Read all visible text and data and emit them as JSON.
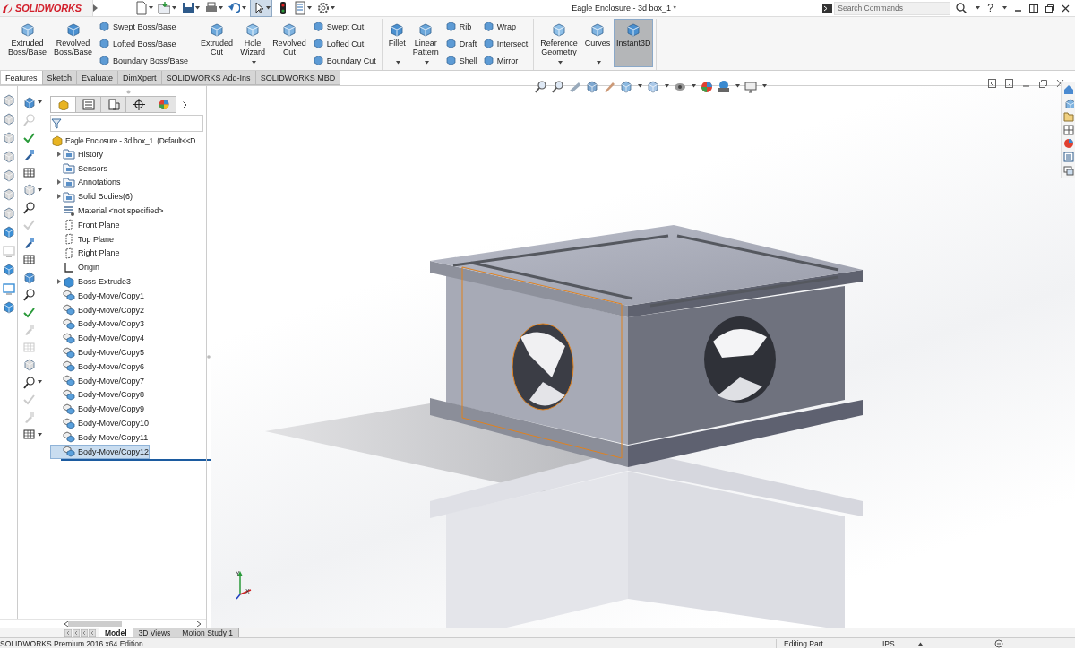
{
  "window": {
    "logo": "SOLIDWORKS",
    "title": "Eagle Enclosure - 3d box_1 *"
  },
  "search": {
    "placeholder": "Search Commands"
  },
  "help": "?",
  "ribbon": {
    "groups": [
      {
        "columns": [
          {
            "kind": "large",
            "label": "Extruded Boss/Base",
            "dropdown": false,
            "selected": false
          },
          {
            "kind": "large",
            "label": "Revolved Boss/Base",
            "dropdown": false,
            "selected": false
          },
          {
            "kind": "small",
            "items": [
              "Swept Boss/Base",
              "Lofted Boss/Base",
              "Boundary Boss/Base"
            ]
          }
        ]
      },
      {
        "columns": [
          {
            "kind": "large",
            "label": "Extruded Cut",
            "dropdown": false,
            "selected": false
          },
          {
            "kind": "large",
            "label": "Hole Wizard",
            "dropdown": true,
            "selected": false
          },
          {
            "kind": "large",
            "label": "Revolved Cut",
            "dropdown": false,
            "selected": false
          },
          {
            "kind": "small",
            "items": [
              "Swept Cut",
              "Lofted Cut",
              "Boundary Cut"
            ]
          }
        ]
      },
      {
        "columns": [
          {
            "kind": "large",
            "label": "Fillet",
            "dropdown": true,
            "selected": false
          },
          {
            "kind": "large",
            "label": "Linear Pattern",
            "dropdown": true,
            "selected": false
          },
          {
            "kind": "small",
            "items": [
              "Rib",
              "Draft",
              "Shell"
            ]
          },
          {
            "kind": "small",
            "items": [
              "Wrap",
              "Intersect",
              "Mirror"
            ]
          }
        ]
      },
      {
        "columns": [
          {
            "kind": "large",
            "label": "Reference Geometry",
            "dropdown": true,
            "selected": false
          },
          {
            "kind": "large",
            "label": "Curves",
            "dropdown": true,
            "selected": false
          },
          {
            "kind": "large",
            "label": "Instant3D",
            "dropdown": false,
            "selected": true
          }
        ]
      }
    ]
  },
  "tabs": [
    {
      "label": "Features",
      "selected": true
    },
    {
      "label": "Sketch",
      "selected": false
    },
    {
      "label": "Evaluate",
      "selected": false
    },
    {
      "label": "DimXpert",
      "selected": false
    },
    {
      "label": "SOLIDWORKS Add-Ins",
      "selected": false
    },
    {
      "label": "SOLIDWORKS MBD",
      "selected": false
    }
  ],
  "left_strip": [
    {
      "disabled": true
    },
    {
      "disabled": true
    },
    {
      "disabled": true
    },
    {
      "disabled": true
    },
    {
      "disabled": true
    },
    {
      "disabled": true
    },
    {
      "disabled": true
    },
    {
      "disabled": false
    },
    {
      "disabled": true
    },
    {
      "disabled": false
    },
    {
      "disabled": false
    },
    {
      "disabled": false
    }
  ],
  "tools": [
    {
      "disabled": false,
      "dropdown": true
    },
    {
      "disabled": true,
      "dropdown": false
    },
    {
      "disabled": false,
      "dropdown": false
    },
    {
      "disabled": false,
      "dropdown": false
    },
    {
      "disabled": false,
      "dropdown": false
    },
    {
      "disabled": true,
      "dropdown": true
    },
    {
      "disabled": false,
      "dropdown": false
    },
    {
      "disabled": true,
      "dropdown": false
    },
    {
      "disabled": false,
      "dropdown": false
    },
    {
      "disabled": false,
      "dropdown": false
    },
    {
      "disabled": false,
      "dropdown": false
    },
    {
      "disabled": false,
      "dropdown": false
    },
    {
      "disabled": false,
      "dropdown": false
    },
    {
      "disabled": true,
      "dropdown": false
    },
    {
      "disabled": true,
      "dropdown": false
    },
    {
      "disabled": true,
      "dropdown": false
    },
    {
      "disabled": false,
      "dropdown": true
    },
    {
      "disabled": true,
      "dropdown": false
    },
    {
      "disabled": true,
      "dropdown": false
    },
    {
      "disabled": false,
      "dropdown": true
    }
  ],
  "panel_tabs": [
    {
      "selected": true
    },
    {
      "selected": false
    },
    {
      "selected": false
    },
    {
      "selected": false
    },
    {
      "selected": false
    }
  ],
  "tree": {
    "root": {
      "label": "Eagle Enclosure - 3d box_1  (Default<<D"
    },
    "items": [
      {
        "kind": "history",
        "label": "History",
        "expandable": true,
        "selected": false
      },
      {
        "kind": "sensors",
        "label": "Sensors",
        "expandable": false,
        "selected": false
      },
      {
        "kind": "annotations",
        "label": "Annotations",
        "expandable": true,
        "selected": false
      },
      {
        "kind": "bodies",
        "label": "Solid Bodies(6)",
        "expandable": true,
        "selected": false
      },
      {
        "kind": "material",
        "label": "Material <not specified>",
        "expandable": false,
        "selected": false
      },
      {
        "kind": "plane",
        "label": "Front Plane",
        "expandable": false,
        "selected": false
      },
      {
        "kind": "plane",
        "label": "Top Plane",
        "expandable": false,
        "selected": false
      },
      {
        "kind": "plane",
        "label": "Right Plane",
        "expandable": false,
        "selected": false
      },
      {
        "kind": "origin",
        "label": "Origin",
        "expandable": false,
        "selected": false
      },
      {
        "kind": "extrude",
        "label": "Boss-Extrude3",
        "expandable": true,
        "selected": false
      },
      {
        "kind": "move",
        "label": "Body-Move/Copy1",
        "expandable": false,
        "selected": false
      },
      {
        "kind": "move",
        "label": "Body-Move/Copy2",
        "expandable": false,
        "selected": false
      },
      {
        "kind": "move",
        "label": "Body-Move/Copy3",
        "expandable": false,
        "selected": false
      },
      {
        "kind": "move",
        "label": "Body-Move/Copy4",
        "expandable": false,
        "selected": false
      },
      {
        "kind": "move",
        "label": "Body-Move/Copy5",
        "expandable": false,
        "selected": false
      },
      {
        "kind": "move",
        "label": "Body-Move/Copy6",
        "expandable": false,
        "selected": false
      },
      {
        "kind": "move",
        "label": "Body-Move/Copy7",
        "expandable": false,
        "selected": false
      },
      {
        "kind": "move",
        "label": "Body-Move/Copy8",
        "expandable": false,
        "selected": false
      },
      {
        "kind": "move",
        "label": "Body-Move/Copy9",
        "expandable": false,
        "selected": false
      },
      {
        "kind": "move",
        "label": "Body-Move/Copy10",
        "expandable": false,
        "selected": false
      },
      {
        "kind": "move",
        "label": "Body-Move/Copy11",
        "expandable": false,
        "selected": false
      },
      {
        "kind": "move",
        "label": "Body-Move/Copy12",
        "expandable": false,
        "selected": true
      }
    ]
  },
  "triad": {
    "y": "Y",
    "x": "X"
  },
  "model_tabs": [
    {
      "label": "Model",
      "selected": true
    },
    {
      "label": "3D Views",
      "selected": false
    },
    {
      "label": "Motion Study 1",
      "selected": false
    }
  ],
  "status_bar": {
    "edition": "SOLIDWORKS Premium 2016 x64 Edition",
    "mode": "Editing Part",
    "units": "IPS"
  }
}
